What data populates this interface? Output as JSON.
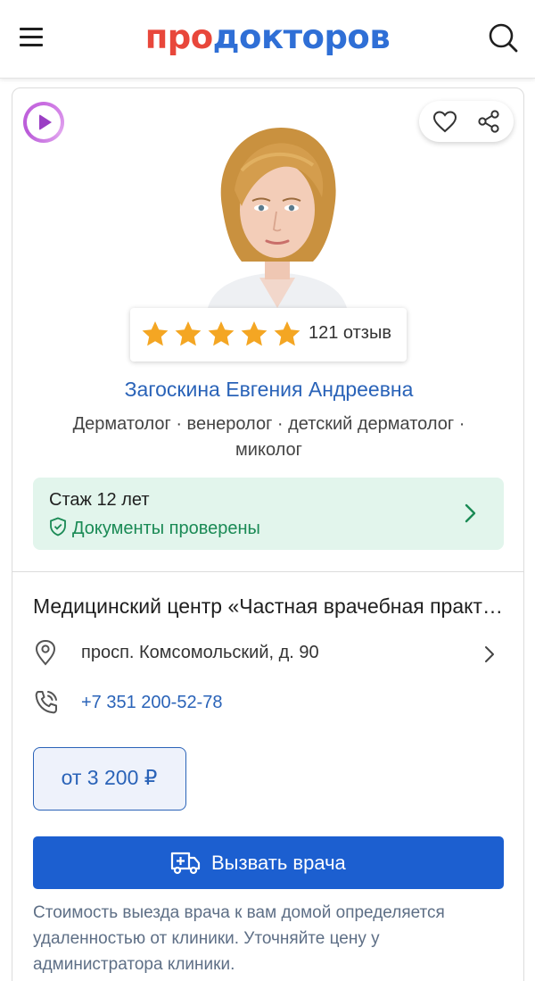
{
  "header": {
    "logo_part1": "про",
    "logo_part2": "докторов",
    "logo_color1": "#e8473b",
    "logo_color2": "#2f6fd6",
    "menu_icon": "hamburger-menu-icon",
    "search_icon": "search-icon"
  },
  "doctor": {
    "rating_stars": 5,
    "reviews_text": "121 отзыв",
    "name": "Загоскина Евгения Андреевна",
    "specialties": "Дерматолог · венеролог · детский дерматолог · миколог",
    "experience": "Стаж 12 лет",
    "verified": "Документы проверены",
    "photo_alt": "doctor-photo"
  },
  "clinic": {
    "name": "Медицинский центр «Частная врачебная практика»",
    "address": "просп. Комсомольский, д. 90",
    "phone": "+7 351 200-52-78"
  },
  "price": {
    "label": "от 3 200 ₽"
  },
  "actions": {
    "call_doctor": "Вызвать врача"
  },
  "note": "Стоимость выезда врача к вам домой определяется удаленностью от клиники. Уточняйте цену у администратора клиники.",
  "colors": {
    "accent_blue": "#2a63b8",
    "button_blue": "#1c5fd0",
    "verified_green": "#1a8a55",
    "exp_bg": "#e2f5ec",
    "star": "#f4a623"
  }
}
